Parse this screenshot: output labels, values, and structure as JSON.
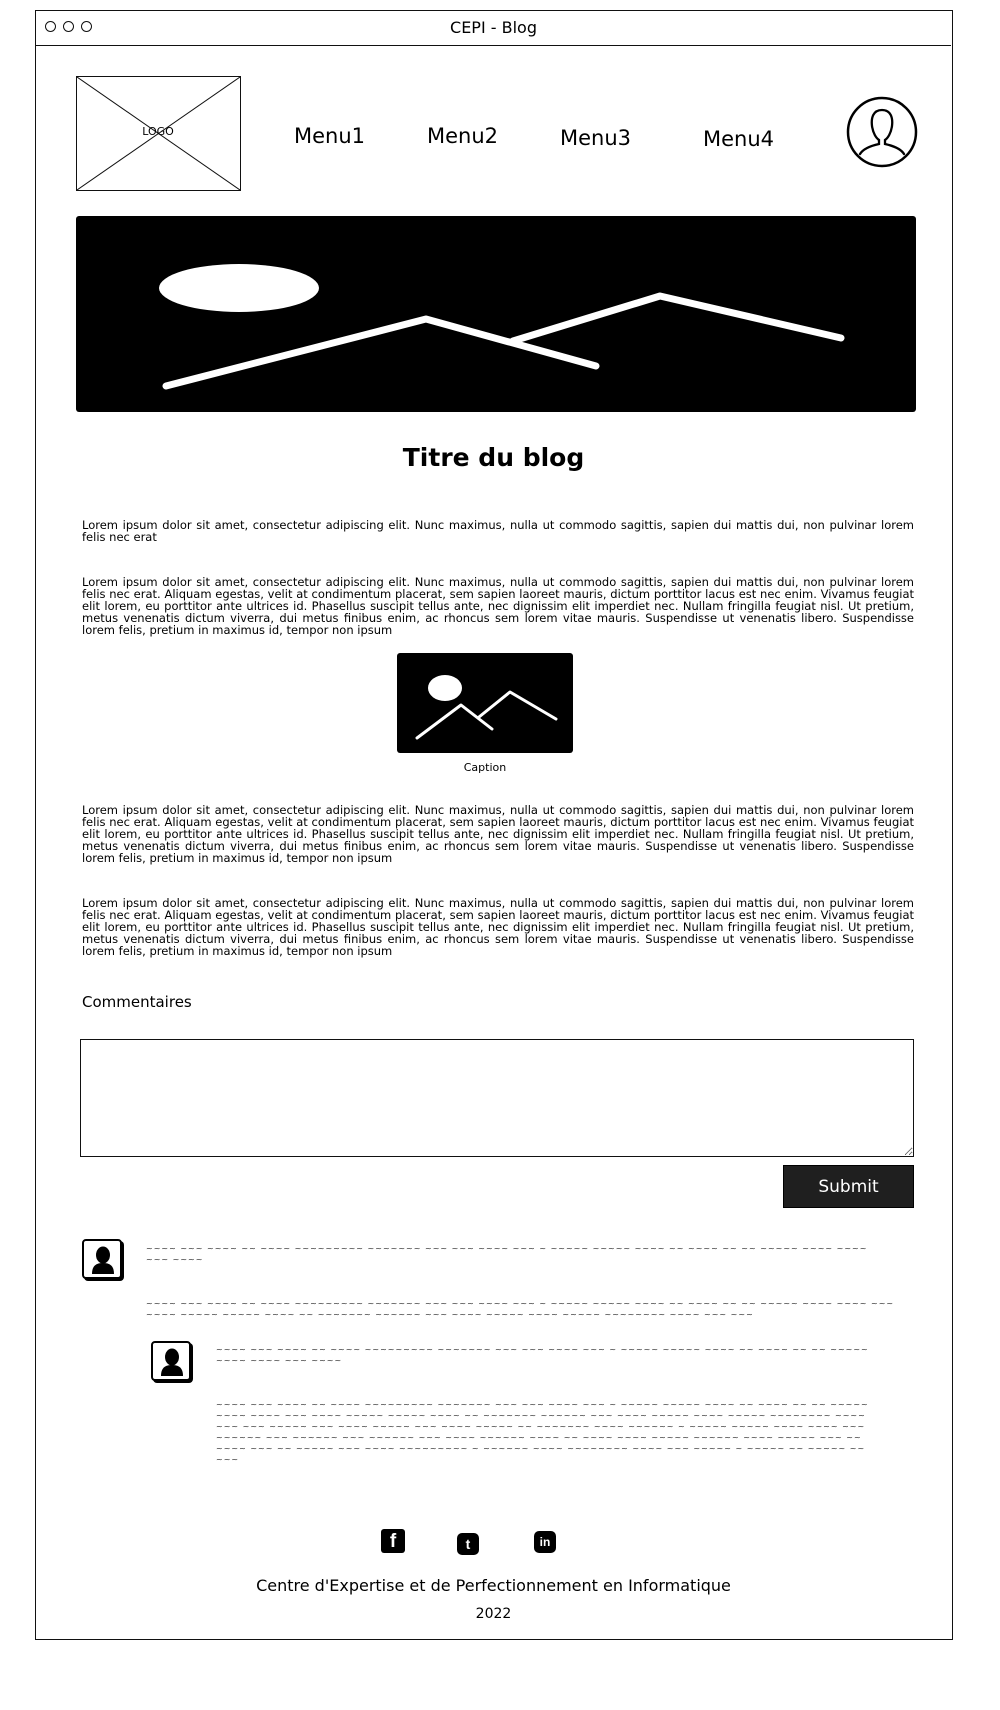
{
  "window": {
    "title": "CEPI - Blog"
  },
  "logo": {
    "label": "LOGO"
  },
  "nav": {
    "items": [
      "Menu1",
      "Menu2",
      "Menu3",
      "Menu4"
    ]
  },
  "article": {
    "title": "Titre du blog",
    "intro": "Lorem ipsum dolor sit amet, consectetur adipiscing elit. Nunc maximus, nulla ut commodo sagittis, sapien dui mattis dui, non pulvinar lorem felis nec erat",
    "paragraph": "Lorem ipsum dolor sit amet, consectetur adipiscing elit. Nunc maximus, nulla ut commodo sagittis, sapien dui mattis dui, non pulvinar lorem felis nec erat. Aliquam egestas, velit at condimentum placerat, sem sapien laoreet mauris, dictum porttitor lacus est nec enim. Vivamus feugiat elit lorem, eu porttitor ante ultrices id. Phasellus suscipit tellus ante, nec dignissim elit imperdiet nec. Nullam fringilla feugiat nisl. Ut pretium, metus venenatis dictum viverra, dui metus finibus enim, ac rhoncus sem lorem vitae mauris. Suspendisse ut venenatis libero. Suspendisse lorem felis, pretium in maximus id, tempor non ipsum",
    "figure_caption": "Caption"
  },
  "comments": {
    "label": "Commentaires",
    "input_value": "",
    "submit_label": "Submit"
  },
  "footer": {
    "social_icons": [
      "facebook-icon",
      "twitter-icon",
      "linkedin-icon"
    ],
    "organization": "Centre d'Expertise et de Perfectionnement en Informatique",
    "year": "2022"
  }
}
